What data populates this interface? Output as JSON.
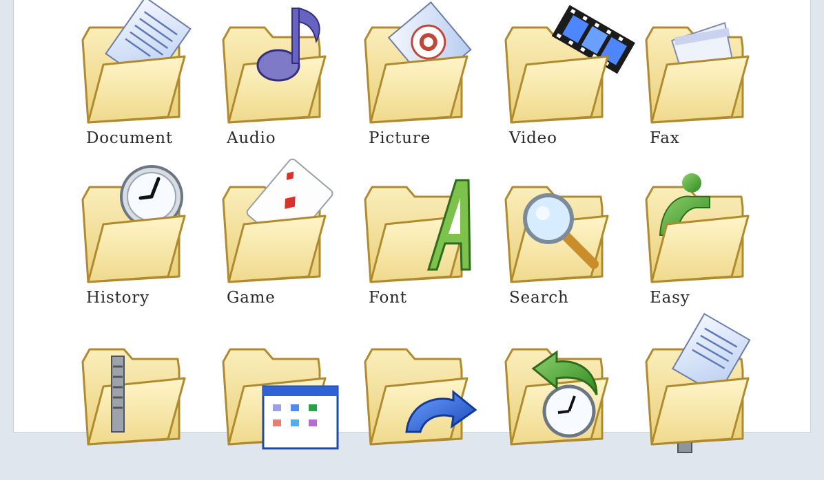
{
  "icons": [
    {
      "label": "Document",
      "icon": "document-folder-icon"
    },
    {
      "label": "Audio",
      "icon": "audio-folder-icon"
    },
    {
      "label": "Picture",
      "icon": "picture-folder-icon"
    },
    {
      "label": "Video",
      "icon": "video-folder-icon"
    },
    {
      "label": "Fax",
      "icon": "fax-folder-icon"
    },
    {
      "label": "History",
      "icon": "history-folder-icon"
    },
    {
      "label": "Game",
      "icon": "game-folder-icon"
    },
    {
      "label": "Font",
      "icon": "font-folder-icon"
    },
    {
      "label": "Search",
      "icon": "search-folder-icon"
    },
    {
      "label": "Easy",
      "icon": "easy-folder-icon"
    },
    {
      "label": "",
      "icon": "zip-folder-icon"
    },
    {
      "label": "",
      "icon": "control-panel-folder-icon"
    },
    {
      "label": "",
      "icon": "sync-folder-icon"
    },
    {
      "label": "",
      "icon": "restore-history-folder-icon"
    },
    {
      "label": "",
      "icon": "network-document-folder-icon"
    }
  ],
  "colors": {
    "folder_fill": "#f7e7a4",
    "folder_stroke": "#b08a2e",
    "label_text": "#2a2a2a"
  }
}
